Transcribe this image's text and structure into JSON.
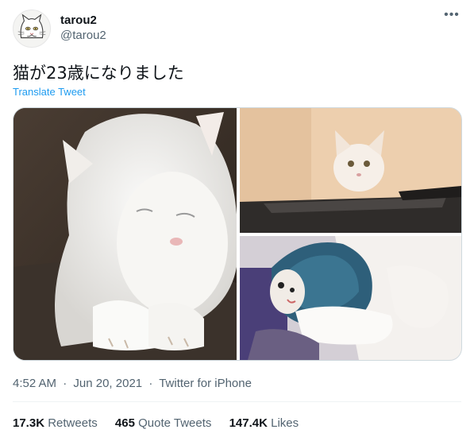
{
  "tweet": {
    "display_name": "tarou2",
    "handle": "@tarou2",
    "text": "猫が23歳になりました",
    "translate_label": "Translate Tweet",
    "more_icon": "more-horizontal-icon",
    "time": "4:52 AM",
    "date": "Jun 20, 2021",
    "source": "Twitter for iPhone",
    "separator": "·"
  },
  "stats": {
    "retweets_count": "17.3K",
    "retweets_label": "Retweets",
    "quotes_count": "465",
    "quotes_label": "Quote Tweets",
    "likes_count": "147.4K",
    "likes_label": "Likes"
  },
  "colors": {
    "link": "#1d9bf0",
    "secondary_text": "#536471",
    "primary_text": "#0f1419",
    "border": "#cfd9de"
  }
}
